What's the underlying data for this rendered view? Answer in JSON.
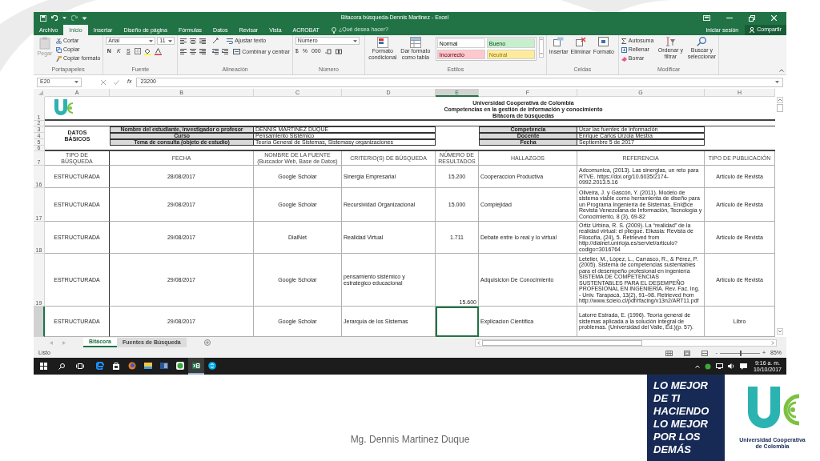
{
  "window": {
    "title": "Bitacora búsqueda-Dennis Martinez - Excel"
  },
  "ribbon": {
    "tabs": [
      {
        "label": "Archivo",
        "selected": false
      },
      {
        "label": "Inicio",
        "selected": true
      },
      {
        "label": "Insertar",
        "selected": false
      },
      {
        "label": "Diseño de página",
        "selected": false
      },
      {
        "label": "Fórmulas",
        "selected": false
      },
      {
        "label": "Datos",
        "selected": false
      },
      {
        "label": "Revisar",
        "selected": false
      },
      {
        "label": "Vista",
        "selected": false
      },
      {
        "label": "ACROBAT",
        "selected": false
      }
    ],
    "tell_me": {
      "placeholder": "¿Qué desea hacer?"
    },
    "sign_in": "Iniciar sesión",
    "share": "Compartir",
    "clipboard": {
      "label": "Portapapeles",
      "paste": "Pegar",
      "commands": [
        "Cortar",
        "Copiar",
        "Copiar formato"
      ]
    },
    "font": {
      "label": "Fuente",
      "family": "Arial",
      "size": "11",
      "styles": [
        "N",
        "K",
        "S"
      ]
    },
    "alignment": {
      "label": "Alineación",
      "wrap": "Ajustar texto",
      "merge": "Combinar y centrar"
    },
    "number": {
      "label": "Número",
      "format": "Número",
      "symbols": [
        "$",
        "%",
        "000"
      ]
    },
    "styles": {
      "label": "Estilos",
      "buttons": [
        "Formato condicional",
        "Dar formato como tabla"
      ],
      "cell_styles": [
        {
          "name": "Normal",
          "color": "#ffffff"
        },
        {
          "name": "Bueno",
          "color": "#c6efce"
        },
        {
          "name": "Incorrecto",
          "color": "#ffc7ce"
        },
        {
          "name": "Neutral",
          "color": "#ffeb9c"
        }
      ]
    },
    "cells": {
      "label": "Celdas",
      "buttons": [
        "Insertar",
        "Eliminar",
        "Formato"
      ]
    },
    "editing": {
      "label": "Modificar",
      "commands": [
        "Autosuma",
        "Rellenar",
        "Borrar"
      ],
      "buttons": [
        "Ordenar y filtrar",
        "Buscar y seleccionar"
      ]
    }
  },
  "formula_bar": {
    "name_box": "E20",
    "function_label": "fx",
    "value": "23200"
  },
  "sheet": {
    "columns": [
      {
        "label": "A",
        "selected": false
      },
      {
        "label": "B",
        "selected": false
      },
      {
        "label": "C",
        "selected": false
      },
      {
        "label": "D",
        "selected": false
      },
      {
        "label": "E",
        "selected": true
      },
      {
        "label": "F",
        "selected": false
      },
      {
        "label": "G",
        "selected": false
      },
      {
        "label": "H",
        "selected": false
      }
    ],
    "header_row_numbers": [
      "1",
      "2",
      "3",
      "4",
      "5",
      "6",
      "7"
    ],
    "title_lines": [
      "Universidad Cooperativa de Colombia",
      "Competencias en la gestión de información y conocimiento",
      "Bitácora de búsquedas"
    ],
    "basic_data": {
      "label": "DATOS BÁSICOS",
      "fields": [
        {
          "label": "Nombre del estudiante, investigador o profesor",
          "value": "DENNIS MARTINEZ DUQUE"
        },
        {
          "label": "Curso",
          "value": "Pensamiento Sistémico"
        },
        {
          "label": "Tema de consulta (objeto de estudio)",
          "value": "Teoría General de Sistemas, Sistemasy organizaciones"
        }
      ]
    },
    "course_data": [
      {
        "label": "Competencia",
        "value": "Usar las fuentes de información"
      },
      {
        "label": "Docente",
        "value": "Enrique Carlos Urzola Mestra"
      },
      {
        "label": "Fecha",
        "value": "Septiembre 5 de 2017"
      }
    ],
    "table": {
      "headers": [
        "TIPO DE\nBÚSQUEDA",
        "FECHA",
        "NOMBRE DE LA FUENTE\n(Buscador Web, Base de Datos)",
        "CRITERIO(S) DE BÚSQUEDA",
        "NÚMERO DE\nRESULTADOS",
        "HALLAZGOS",
        "REFERENCIA",
        "TIPO DE PUBLICACIÓN"
      ],
      "rows": [
        {
          "number": "16",
          "selected": false,
          "results_at_bottom": false,
          "cells": [
            "ESTRUCTURADA",
            "28/08/2017",
            "Google Scholar",
            "Sinergia Empresarial",
            "15.200",
            "Cooperaccion Productiva",
            "Adcomunica, (2013). Las sinergias, un reto para RTVE. https://doi.org/10.6035/2174-0992.2013.5.16",
            "Artículo de Revista"
          ]
        },
        {
          "number": "17",
          "selected": false,
          "results_at_bottom": false,
          "cells": [
            "ESTRUCTURADA",
            "29/08/2017",
            "Google Scholar",
            "Recursividad Organizacional",
            "15.000",
            "Complejidad",
            "Oliveira, J. y Gascón, Y. (2011). Modelo de sistema viable como herramienta de diseño para un Programa Ingeniería de Sistemas. Enl@ce Revista Venezolana de Información, Tecnología y Conocimiento, 8 (3), 69-82",
            "Artículo de Revista"
          ]
        },
        {
          "number": "18",
          "selected": false,
          "results_at_bottom": false,
          "cells": [
            "ESTRUCTURADA",
            "29/08/2017",
            "DialNet",
            "Realidad Virtual",
            "1.711",
            "Debate entre lo real y lo virtual",
            "Ortiz Urbina, R. S. (2009). La “realidad” de la realidad virtual: el pliegue. Eikasia: Revista de Filosofía, (24), 5. Retrieved from http://dialnet.unirioja.es/servlet/articulo?codigo=3016764",
            "Artículo de Revista"
          ]
        },
        {
          "number": "19",
          "selected": false,
          "results_at_bottom": true,
          "cells": [
            "ESTRUCTURADA",
            "29/08/2017",
            "Google Scholar",
            "pensamiento sistémico y estrategico educacional",
            "15.600",
            "Adquisicion De Conocimiento",
            "Letelier, M., López, L., Carrasco, R., & Pérez, P. (2005). Sistema de competencias sustentables para el desempeño profesional en ingeniería SISTEMA DE COMPETENCIAS SUSTENTABLES PARA EL DESEMPEÑO PROFESIONAL EN INGENIERÍA. Rev. Fac. Ing. - Univ. Tarapacá, 13(2), 91–98. Retrieved from http://www.scielo.cl/pdf/rfacing/v13n2/ART11.pdf",
            "Artículo de Revista"
          ]
        },
        {
          "selected": true,
          "results_at_bottom": false,
          "cells": [
            "ESTRUCTURADA",
            "29/08/2017",
            "Google Scholar",
            "Jerarquia de los Sistemas",
            null,
            "Explicacion Cientifica",
            "Latorre Estrada, E. (1996). Teoría general de sistemas aplicada a la solución integral de problemas. (Universidad del Valle, Ed.)(p. 57).",
            "Libro"
          ]
        }
      ]
    }
  },
  "sheet_tabs": [
    {
      "label": "Bitácora",
      "selected": true
    },
    {
      "label": "Fuentes de Búsqueda",
      "selected": false
    }
  ],
  "status_bar": {
    "status": "Listo",
    "zoom": {
      "minus": "-",
      "plus": "+",
      "level": 0.5,
      "reading": "85%"
    }
  },
  "taskbar": {
    "apps": [
      {
        "kind": "browser",
        "selected": false
      },
      {
        "kind": "store",
        "selected": false
      },
      {
        "kind": "globe",
        "selected": false
      },
      {
        "kind": "folder",
        "selected": false
      },
      {
        "kind": "document",
        "selected": false
      },
      {
        "kind": "app",
        "selected": false
      },
      {
        "kind": "spreadsheet",
        "selected": true
      },
      {
        "kind": "chat",
        "selected": false
      }
    ],
    "time": "9:16 a. m.",
    "date": "10/10/2017"
  },
  "slide": {
    "footer": "Mg. Dennis Martinez Duque",
    "slogan_lines": [
      "LO MEJOR",
      "DE TI",
      "HACIENDO",
      "LO MEJOR",
      "POR LOS",
      "DEMÁS"
    ],
    "logo_caption": "Universidad Cooperativa de Colombia"
  }
}
